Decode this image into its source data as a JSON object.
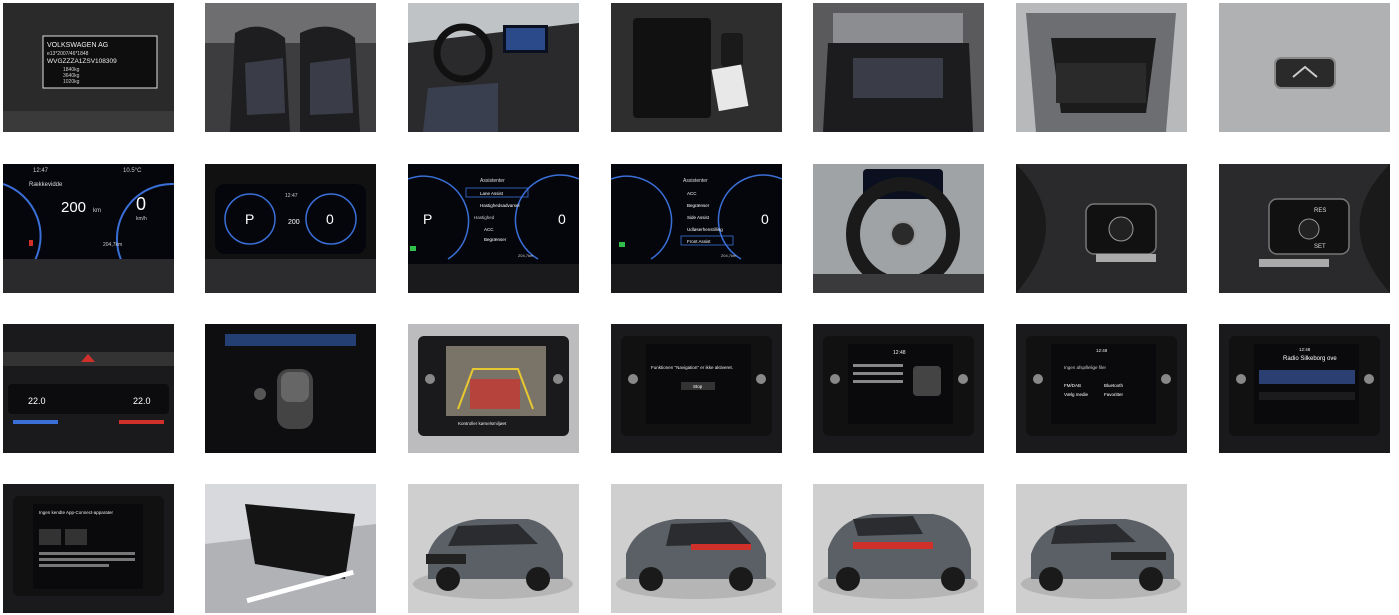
{
  "gallery": {
    "photos": [
      {
        "subject": "vin-plate",
        "text": {
          "line1": "VOLKSWAGEN AG",
          "line2": "e13*2007/46*1848",
          "line3": "WVGZZZA1ZSV108309",
          "weights": [
            "1840kg",
            "3640kg",
            "1020kg",
            "0810kg"
          ]
        }
      },
      {
        "subject": "front-seats"
      },
      {
        "subject": "dashboard-interior"
      },
      {
        "subject": "manual-and-keys"
      },
      {
        "subject": "rear-seats"
      },
      {
        "subject": "trunk"
      },
      {
        "subject": "trunk-release-button"
      },
      {
        "subject": "cluster-range",
        "text": {
          "time": "12:47",
          "temp": "10.5°C",
          "title": "Rækkevidde",
          "range": "200",
          "unit": "km",
          "speed": "0",
          "speed_unit": "km/h",
          "odo": "204,7km"
        }
      },
      {
        "subject": "cluster-overview",
        "text": {
          "time": "12:47",
          "gear": "P",
          "range": "200",
          "speed": "0"
        }
      },
      {
        "subject": "cluster-assist-menu-1",
        "text": {
          "header": "Assistenter",
          "items": [
            "Lane Assist",
            "Hastighedsadvarsel",
            "Hastighed",
            "ACC",
            "Begrænser"
          ],
          "gear": "P",
          "speed": "0",
          "odo": "204,7km"
        }
      },
      {
        "subject": "cluster-assist-menu-2",
        "text": {
          "header": "Assistenter",
          "items": [
            "ACC",
            "Begrænser",
            "Side Assist",
            "Udløserhenstilling",
            "Front Assist"
          ],
          "speed": "0",
          "odo": "204,7km"
        }
      },
      {
        "subject": "steering-wheel"
      },
      {
        "subject": "steering-left-controls"
      },
      {
        "subject": "steering-right-controls",
        "text": {
          "res": "RES",
          "set": "SET"
        }
      },
      {
        "subject": "climate-panel",
        "text": {
          "temp_left": "22.0",
          "temp_right": "22.0"
        }
      },
      {
        "subject": "gear-selector"
      },
      {
        "subject": "rear-camera",
        "text": {
          "note": "Kontroller kørselsmiljøet"
        }
      },
      {
        "subject": "infotainment-navigation",
        "text": {
          "message": "Funktionen \"Navigation\" er ikke aktiveret.",
          "button": "Stop"
        }
      },
      {
        "subject": "infotainment-phone",
        "text": {
          "clock": "12:48"
        }
      },
      {
        "subject": "infotainment-media",
        "text": {
          "clock": "12:48",
          "title": "Ingen afspillelige filer",
          "items": [
            "FM/DAB",
            "Vælg medie",
            "Bluetooth",
            "Favoritter"
          ]
        }
      },
      {
        "subject": "infotainment-radio",
        "text": {
          "clock": "12:48",
          "station": "Radio Silkeborg ove"
        }
      },
      {
        "subject": "infotainment-app-connect",
        "text": {
          "title": "Ingen kendte App-Connect-apparater"
        }
      },
      {
        "subject": "rear-view-mirror"
      },
      {
        "subject": "car-front-3q"
      },
      {
        "subject": "car-rear-3q"
      },
      {
        "subject": "car-rear"
      },
      {
        "subject": "car-front"
      }
    ]
  },
  "colors": {
    "car_body": "#5b6066",
    "studio_bg": "#cfcfcf",
    "cluster_blue": "#3a6fd8",
    "warning_red": "#d0302a",
    "dark_interior": "#1c1c1e"
  }
}
